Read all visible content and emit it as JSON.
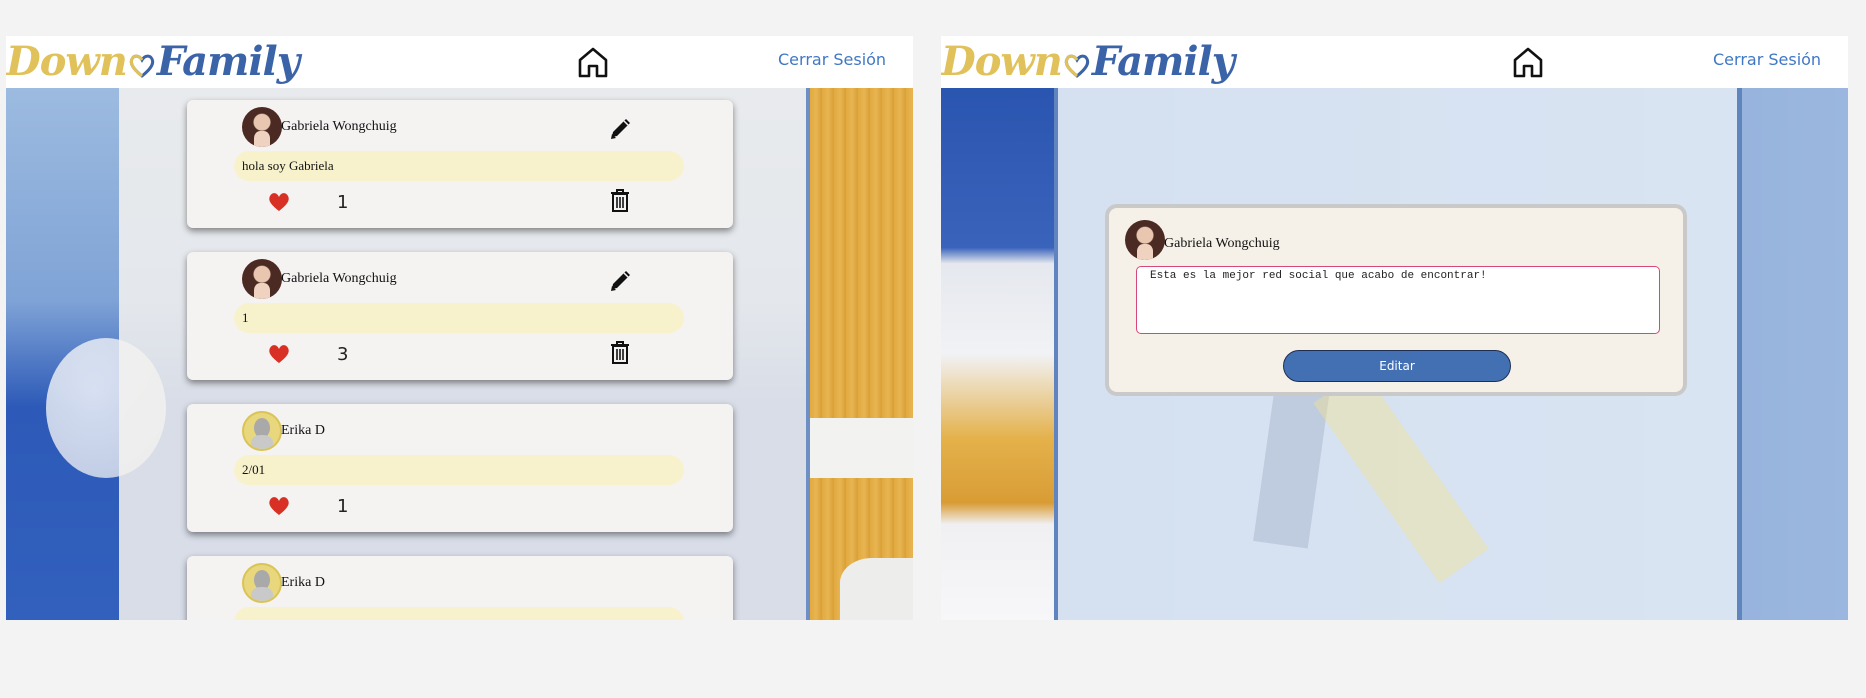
{
  "brand": {
    "part1": "Down",
    "part2": "Family"
  },
  "header": {
    "logout_label": "Cerrar Sesión"
  },
  "feed": {
    "posts": [
      {
        "author": "Gabriela Wongchuig",
        "text": "hola soy Gabriela",
        "likes": "1",
        "editable": true,
        "deletable": true
      },
      {
        "author": "Gabriela Wongchuig",
        "text": "1",
        "likes": "3",
        "editable": true,
        "deletable": true
      },
      {
        "author": "Erika D",
        "text": "2/01",
        "likes": "1",
        "editable": false,
        "deletable": false
      },
      {
        "author": "Erika D",
        "text": "",
        "likes": "",
        "editable": false,
        "deletable": false
      }
    ]
  },
  "edit_modal": {
    "author": "Gabriela Wongchuig",
    "textarea_value": "Esta es la mejor red social que acabo de encontrar!",
    "submit_label": "Editar"
  },
  "colors": {
    "accent_blue": "#3f78c4",
    "button_blue": "#4370b3",
    "logo_yellow": "#e0c15a",
    "logo_blue": "#3b63a8",
    "heart_red": "#d93025",
    "message_bg": "#f7f2cc"
  },
  "icons": {
    "home": "home-icon",
    "edit": "pencil-icon",
    "like": "heart-icon",
    "delete": "trash-icon"
  }
}
